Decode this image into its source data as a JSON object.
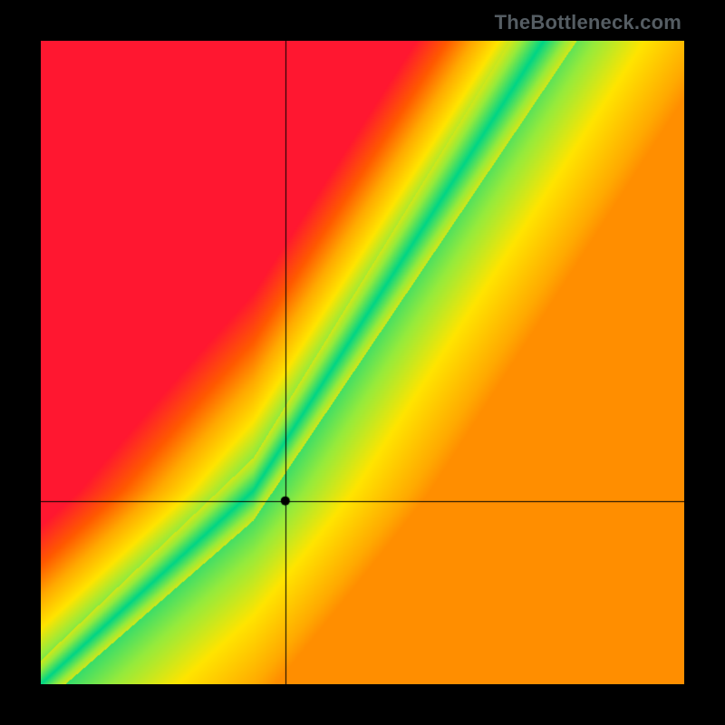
{
  "watermark": "TheBottleneck.com",
  "chart_data": {
    "type": "heatmap",
    "title": "",
    "xlabel": "",
    "ylabel": "",
    "xlim": [
      0,
      1
    ],
    "ylim": [
      0,
      1
    ],
    "crosshair": {
      "x": 0.38,
      "y": 0.285
    },
    "marker": {
      "x": 0.38,
      "y": 0.285
    },
    "optimal_curve": {
      "description": "green ridge where bottleneck is minimal; linear from origin with a steepening slope past the knee",
      "knee": {
        "x": 0.33,
        "y": 0.3
      },
      "slope_before_knee": 0.91,
      "slope_after_knee": 1.55
    },
    "color_scale": {
      "low_mismatch": "#00d586",
      "mid": "#ffe500",
      "high_mismatch_warm": "#ff8a00",
      "high_mismatch": "#ff1730"
    },
    "series": [
      {
        "name": "optimal ridge (sample points)",
        "points": [
          [
            0.0,
            0.0
          ],
          [
            0.1,
            0.09
          ],
          [
            0.2,
            0.18
          ],
          [
            0.3,
            0.27
          ],
          [
            0.33,
            0.3
          ],
          [
            0.4,
            0.41
          ],
          [
            0.5,
            0.56
          ],
          [
            0.6,
            0.72
          ],
          [
            0.7,
            0.87
          ],
          [
            0.78,
            0.99
          ]
        ]
      }
    ]
  }
}
